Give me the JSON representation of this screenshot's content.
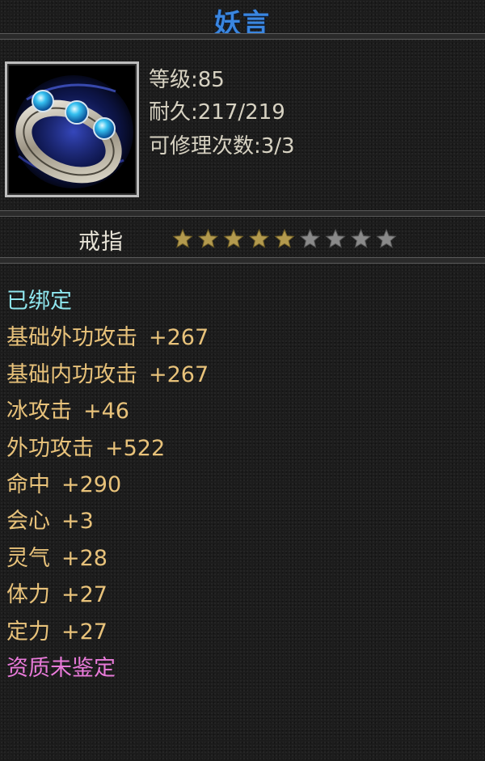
{
  "item": {
    "name": "妖言",
    "icon": "ring-icon",
    "level_text": "等级:85",
    "durability_text": "耐久:217/219",
    "repair_text": "可修理次数:3/3",
    "type": "戒指",
    "stars": {
      "filled": 5,
      "total": 9
    }
  },
  "attributes": [
    {
      "name": "已绑定",
      "value": ""
    },
    {
      "name": "基础外功攻击",
      "value": "+267"
    },
    {
      "name": "基础内功攻击",
      "value": "+267"
    },
    {
      "name": "冰攻击",
      "value": "+46"
    },
    {
      "name": "外功攻击",
      "value": "+522"
    },
    {
      "name": "命中",
      "value": "+290"
    },
    {
      "name": "会心",
      "value": "+3"
    },
    {
      "name": "灵气",
      "value": "+28"
    },
    {
      "name": "体力",
      "value": "+27"
    },
    {
      "name": "定力",
      "value": "+27"
    },
    {
      "name": "资质未鉴定",
      "value": ""
    }
  ],
  "colors": {
    "name": "#3a86e0",
    "bound": "#8fe6ee",
    "stat": "#e8c27a",
    "quality": "#e87ad9",
    "star_filled": "#b39a4e",
    "star_empty": "#8a8a8a"
  }
}
